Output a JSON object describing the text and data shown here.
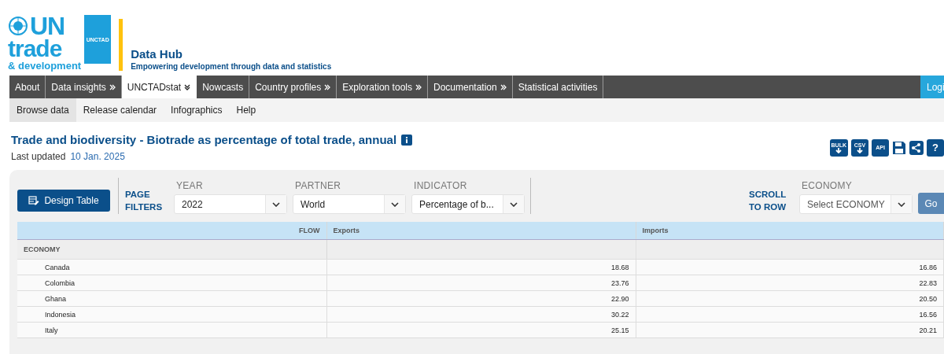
{
  "logo": {
    "line_1": "UN",
    "line_2": "trade",
    "line_3": "& development",
    "badge": "UNCTAD"
  },
  "site": {
    "title": "Data Hub",
    "tagline": "Empowering development through data and statistics"
  },
  "nav": [
    {
      "label": "About",
      "kind": "plain",
      "selected": false
    },
    {
      "label": "Data insights",
      "kind": "more",
      "selected": false
    },
    {
      "label": "UNCTADstat",
      "kind": "menu",
      "selected": true
    },
    {
      "label": "Nowcasts",
      "kind": "plain",
      "selected": false
    },
    {
      "label": "Country profiles",
      "kind": "more",
      "selected": false
    },
    {
      "label": "Exploration tools",
      "kind": "more",
      "selected": false
    },
    {
      "label": "Documentation",
      "kind": "more",
      "selected": false
    },
    {
      "label": "Statistical activities",
      "kind": "plain",
      "selected": false
    }
  ],
  "login": "Logi",
  "subnav": [
    {
      "label": "Browse data",
      "selected": true
    },
    {
      "label": "Release calendar",
      "selected": false
    },
    {
      "label": "Infographics",
      "selected": false
    },
    {
      "label": "Help",
      "selected": false
    }
  ],
  "heading": {
    "title": "Trade and biodiversity - Biotrade as percentage of total trade, annual",
    "updated_label": "Last updated",
    "updated_date": "10 Jan. 2025"
  },
  "tools": [
    {
      "kind": "bulk",
      "label": "BULK"
    },
    {
      "kind": "csv",
      "label": "CSV"
    },
    {
      "kind": "api",
      "label": "API"
    },
    {
      "kind": "save"
    },
    {
      "kind": "share"
    },
    {
      "kind": "help",
      "label": "?"
    }
  ],
  "design_button": "Design Table",
  "page_filters_label": "PAGE FILTERS",
  "filters": [
    {
      "label": "YEAR",
      "value": "2022"
    },
    {
      "label": "PARTNER",
      "value": "World"
    },
    {
      "label": "INDICATOR",
      "value": "Percentage of b..."
    }
  ],
  "scroll_to_row": {
    "label": "SCROLL TO ROW",
    "field_label": "ECONOMY",
    "placeholder": "Select ECONOMY",
    "button": "Go"
  },
  "table": {
    "corner_top": "FLOW",
    "corner_bottom": "ECONOMY",
    "columns": [
      "Exports",
      "Imports"
    ],
    "rows": [
      {
        "economy": "Canada",
        "values": [
          "18.68",
          "16.86"
        ]
      },
      {
        "economy": "Colombia",
        "values": [
          "23.76",
          "22.83"
        ]
      },
      {
        "economy": "Ghana",
        "values": [
          "22.90",
          "20.50"
        ]
      },
      {
        "economy": "Indonesia",
        "values": [
          "30.22",
          "16.56"
        ]
      },
      {
        "economy": "Italy",
        "values": [
          "25.15",
          "20.21"
        ]
      }
    ]
  }
}
